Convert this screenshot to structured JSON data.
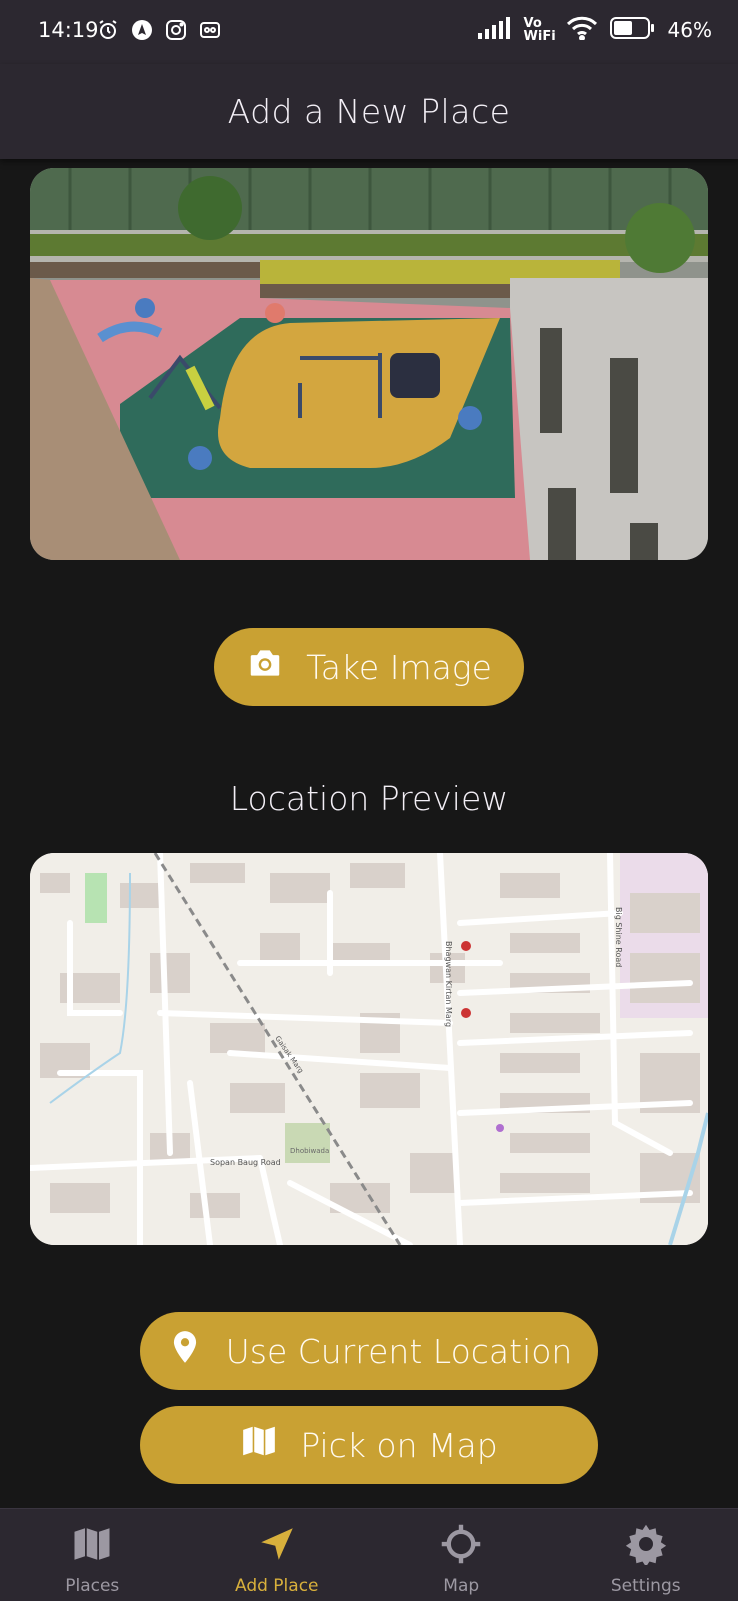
{
  "status_bar": {
    "time": "14:19",
    "battery_percent": "46%",
    "network_label": "Vo WiFi",
    "left_icons": [
      "alarm-icon",
      "navigation-app-icon",
      "instagram-icon",
      "voicemail-icon"
    ],
    "right_icons": [
      "signal-icon",
      "vowifi-icon",
      "wifi-icon",
      "battery-icon"
    ]
  },
  "header": {
    "title": "Add a New Place"
  },
  "image_section": {
    "take_image_label": "Take Image",
    "take_image_icon": "camera-icon"
  },
  "location_section": {
    "title": "Location Preview",
    "use_current_location_label": "Use Current Location",
    "use_current_location_icon": "location-pin-icon",
    "pick_on_map_label": "Pick on Map",
    "pick_on_map_icon": "map-icon",
    "map_labels": {
      "road_1": "Sopan Baug Road",
      "road_2": "Bhagwan Kirtan Marg",
      "road_3": "Big Shine Road",
      "road_4": "Gaisak Marg",
      "place_1": "Dhobiwada"
    }
  },
  "bottom_nav": {
    "items": [
      {
        "label": "Places",
        "icon": "map-icon",
        "active": false
      },
      {
        "label": "Add Place",
        "icon": "navigation-arrow-icon",
        "active": true
      },
      {
        "label": "Map",
        "icon": "crosshair-icon",
        "active": false
      },
      {
        "label": "Settings",
        "icon": "gear-icon",
        "active": false
      }
    ]
  },
  "colors": {
    "accent": "#c9a133",
    "active_tab": "#d8b03c",
    "background": "#171717",
    "bar": "#2c2830",
    "inactive_tab": "#9c98a2"
  }
}
